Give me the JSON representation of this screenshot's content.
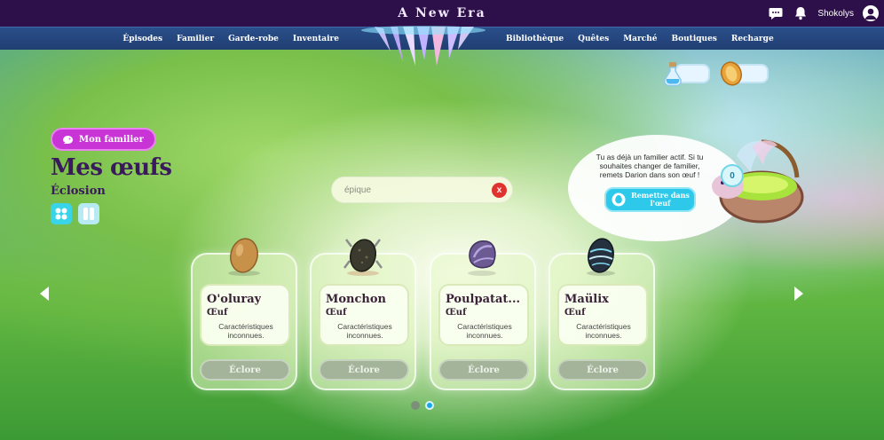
{
  "app": {
    "title": "A New Era"
  },
  "topbar": {
    "username": "Shokolys",
    "icons": [
      "chat-icon",
      "bell-icon",
      "user-icon"
    ]
  },
  "nav": {
    "left": [
      "Épisodes",
      "Familier",
      "Garde-robe",
      "Inventaire"
    ],
    "right": [
      "Bibliothèque",
      "Quêtes",
      "Marché",
      "Boutiques",
      "Recharge"
    ]
  },
  "currency": {
    "potions": "",
    "coins": ""
  },
  "header": {
    "tag": "Mon familier",
    "title": "Mes œufs",
    "subtitle": "Éclosion"
  },
  "search": {
    "placeholder": "épique",
    "value": "",
    "clear": "x"
  },
  "bubble": {
    "text": "Tu as déjà un familier actif. Si tu souhaites changer de familier, remets Darion dans son œuf !",
    "button": "Remettre dans l'œuf",
    "count": "0"
  },
  "eggs": [
    {
      "name": "O'oluray",
      "type": "Œuf",
      "desc": "Caractéristiques inconnues.",
      "button": "Éclore",
      "color": "#c89149"
    },
    {
      "name": "Monchon",
      "type": "Œuf",
      "desc": "Caractéristiques inconnues.",
      "button": "Éclore",
      "color": "#3b3a2e"
    },
    {
      "name": "Poulpatat...",
      "type": "Œuf",
      "desc": "Caractéristiques inconnues.",
      "button": "Éclore",
      "color": "#6c5a93"
    },
    {
      "name": "Maülix",
      "type": "Œuf",
      "desc": "Caractéristiques inconnues.",
      "button": "Éclore",
      "color": "#26313f"
    }
  ],
  "pagination": {
    "pages": 2,
    "current": 2
  },
  "colors": {
    "topbar": "#2d0f4a",
    "navbar": "#203e72",
    "accent_pink": "#c834d6",
    "accent_cyan": "#2ec9ea",
    "clear_red": "#e0322e"
  }
}
